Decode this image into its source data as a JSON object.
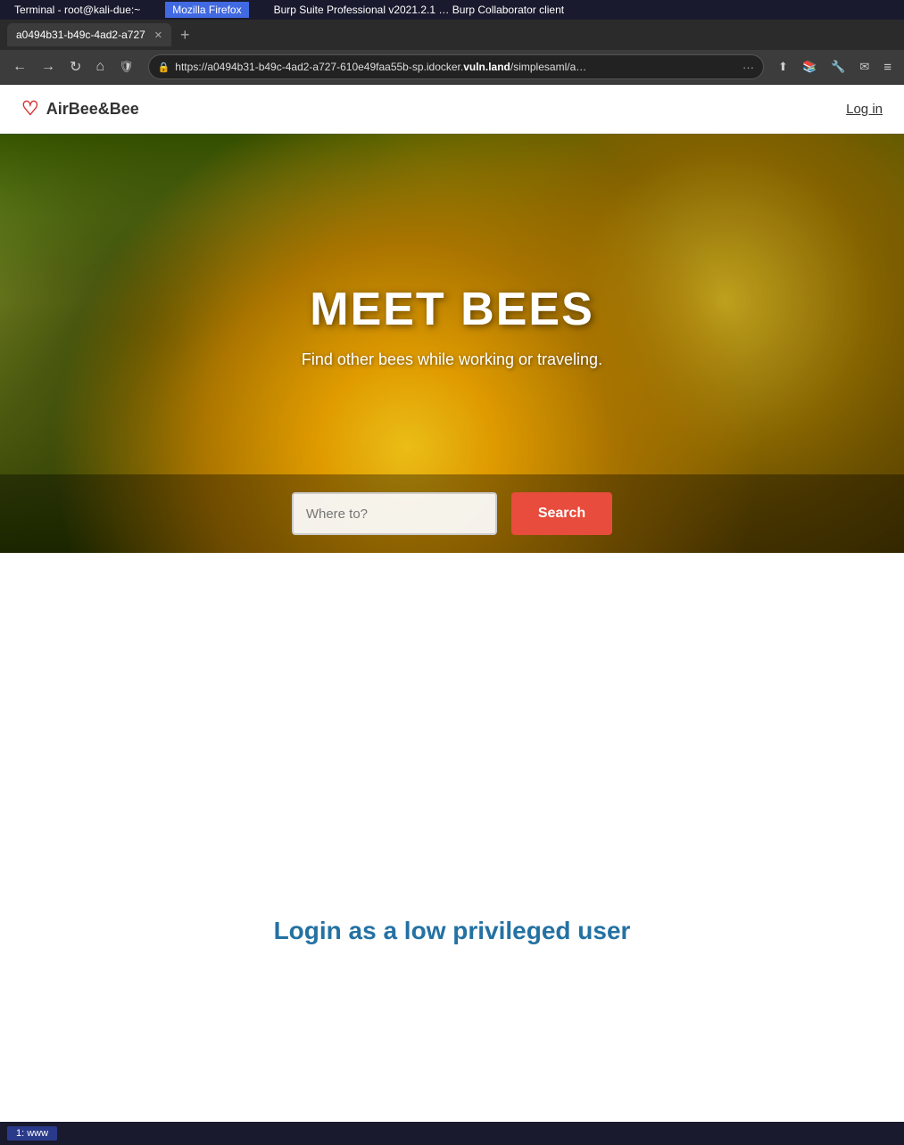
{
  "os_taskbar": {
    "items": [
      {
        "label": "Terminal - root@kali-due:~",
        "active": false
      },
      {
        "label": "Mozilla Firefox",
        "active": true
      },
      {
        "label": "Burp Suite Professional v2021.2.1 … Burp Collaborator client",
        "active": false
      }
    ]
  },
  "browser": {
    "tab": {
      "label": "a0494b31-b49c-4ad2-a727",
      "active": true
    },
    "new_tab_label": "+",
    "address": {
      "protocol_icon": "🔒",
      "url_display": "https://a0494b31-b49c-4ad2-a727-610e49faa55b-sp.idocker.",
      "url_bold": "vuln.land",
      "url_rest": "/simplesaml/a…",
      "more_options": "···"
    },
    "nav": {
      "back": "←",
      "forward": "→",
      "refresh": "↻",
      "home": "⌂",
      "shield": "🛡"
    }
  },
  "site": {
    "header": {
      "logo_icon": "♡",
      "logo_text": "AirBee&Bee",
      "login_label": "Log in"
    },
    "hero": {
      "title": "MEET BEES",
      "subtitle": "Find other bees while working or traveling."
    },
    "search": {
      "placeholder": "Where to?",
      "button_label": "Search"
    },
    "main": {
      "low_priv_heading": "Login as a low privileged user"
    }
  },
  "bottom_taskbar": {
    "items": [
      {
        "label": "1: www"
      }
    ]
  }
}
